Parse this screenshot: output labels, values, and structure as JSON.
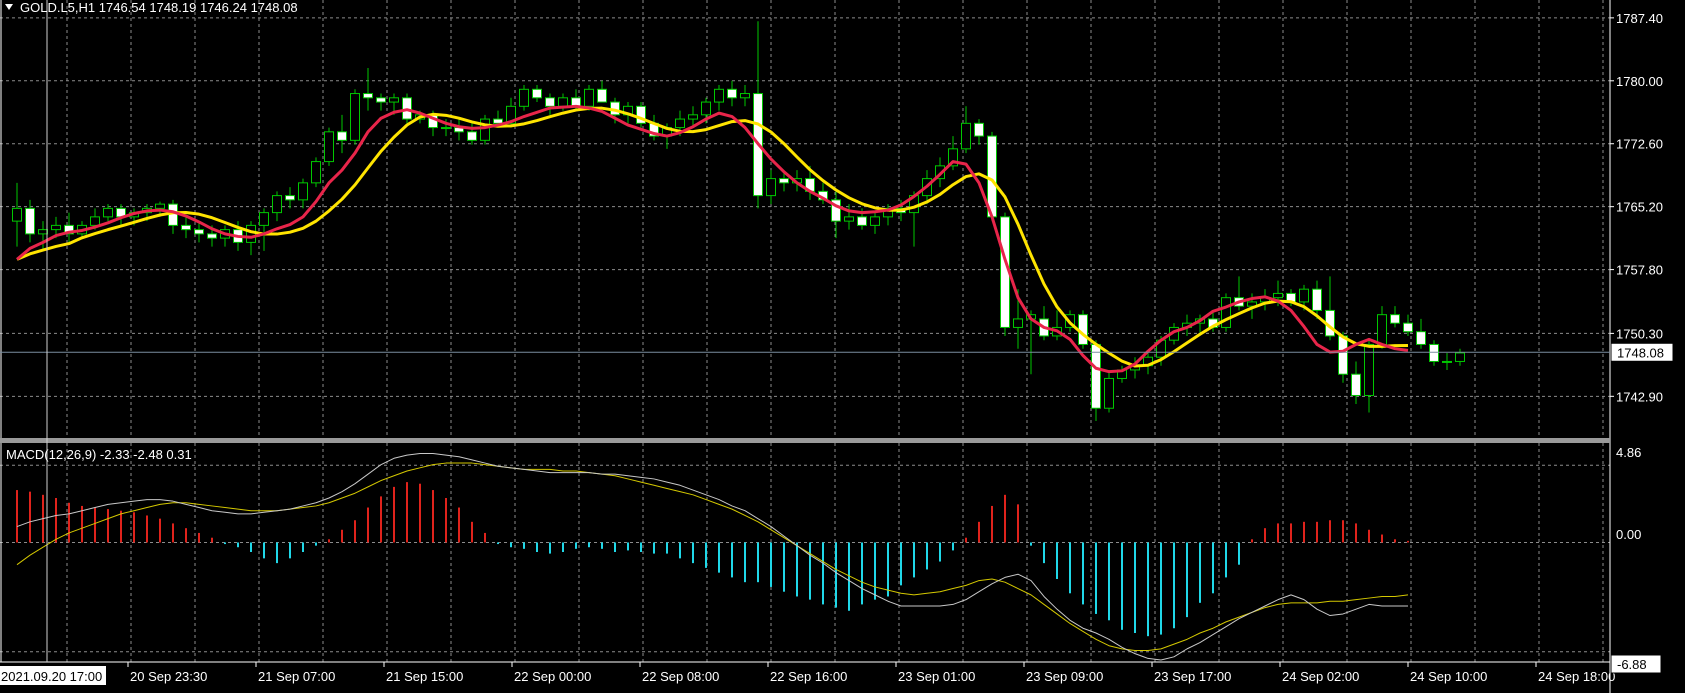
{
  "header": {
    "symbol_line": "GOLD.L5,H1  1746.54 1748.19 1746.24 1748.08"
  },
  "macd_panel": {
    "label": "MACD(12,26,9) -2.33 -2.48 0.31",
    "top_value": "4.86",
    "zero_value": "0.00",
    "bottom_value": "-6.88"
  },
  "colors": {
    "background": "#000000",
    "grid": "#8c8c8c",
    "bull_candle": "#00c800",
    "bear_candle": "#ffffff",
    "ma_fast": "#e8254a",
    "ma_slow": "#ffe400",
    "hist_pos": "#e0231c",
    "hist_neg": "#20d8e8",
    "macd_line": "#c8c8c8",
    "signal_line": "#d4c800"
  },
  "chart_data": [
    {
      "type": "candlestick",
      "symbol": "GOLD.L5",
      "timeframe": "H1",
      "last_price": "1748.08",
      "ylim": [
        1738.0,
        1789.5
      ],
      "price_ticks": [
        "1787.40",
        "1780.00",
        "1772.60",
        "1765.20",
        "1757.80",
        "1750.30",
        "1742.90"
      ],
      "time_ticks": [
        "2021.09.20 17:00",
        "20 Sep 23:30",
        "21 Sep 07:00",
        "21 Sep 15:00",
        "22 Sep 00:00",
        "22 Sep 08:00",
        "22 Sep 16:00",
        "23 Sep 01:00",
        "23 Sep 09:00",
        "23 Sep 17:00",
        "24 Sep 02:00",
        "24 Sep 10:00",
        "24 Sep 18:00"
      ],
      "candles": [
        [
          1763.5,
          1768.0,
          1760.5,
          1765.0
        ],
        [
          1765.0,
          1766.0,
          1761.0,
          1762.0
        ],
        [
          1762.0,
          1763.5,
          1760.0,
          1762.5
        ],
        [
          1762.5,
          1764.0,
          1761.5,
          1763.0
        ],
        [
          1763.0,
          1764.5,
          1761.0,
          1762.0
        ],
        [
          1762.0,
          1763.5,
          1761.5,
          1763.0
        ],
        [
          1763.0,
          1765.0,
          1762.5,
          1764.0
        ],
        [
          1764.0,
          1765.5,
          1763.5,
          1765.0
        ],
        [
          1765.0,
          1765.5,
          1763.0,
          1764.0
        ],
        [
          1764.0,
          1765.0,
          1763.0,
          1764.5
        ],
        [
          1764.5,
          1765.5,
          1763.5,
          1765.0
        ],
        [
          1765.0,
          1765.8,
          1764.0,
          1765.5
        ],
        [
          1765.5,
          1766.0,
          1762.0,
          1763.0
        ],
        [
          1763.0,
          1764.0,
          1761.5,
          1762.5
        ],
        [
          1762.5,
          1763.5,
          1761.0,
          1762.0
        ],
        [
          1762.0,
          1763.0,
          1760.5,
          1761.5
        ],
        [
          1761.5,
          1763.0,
          1760.5,
          1762.5
        ],
        [
          1762.5,
          1763.5,
          1760.0,
          1761.0
        ],
        [
          1761.0,
          1763.5,
          1759.5,
          1763.0
        ],
        [
          1763.0,
          1765.0,
          1760.0,
          1764.5
        ],
        [
          1764.5,
          1767.0,
          1763.5,
          1766.5
        ],
        [
          1766.5,
          1767.5,
          1765.0,
          1766.0
        ],
        [
          1766.0,
          1768.5,
          1765.0,
          1768.0
        ],
        [
          1768.0,
          1771.0,
          1767.5,
          1770.5
        ],
        [
          1770.5,
          1774.5,
          1770.0,
          1774.0
        ],
        [
          1774.0,
          1776.0,
          1771.5,
          1773.0
        ],
        [
          1773.0,
          1779.0,
          1772.5,
          1778.5
        ],
        [
          1778.5,
          1781.5,
          1776.5,
          1778.0
        ],
        [
          1778.0,
          1778.5,
          1776.5,
          1777.5
        ],
        [
          1777.5,
          1778.5,
          1776.0,
          1778.0
        ],
        [
          1778.0,
          1778.5,
          1775.0,
          1775.5
        ],
        [
          1775.5,
          1776.5,
          1775.0,
          1776.0
        ],
        [
          1776.0,
          1776.5,
          1773.5,
          1774.5
        ],
        [
          1774.5,
          1775.5,
          1773.5,
          1774.5
        ],
        [
          1774.5,
          1775.5,
          1773.0,
          1774.0
        ],
        [
          1774.0,
          1775.0,
          1772.5,
          1773.0
        ],
        [
          1773.0,
          1776.0,
          1772.5,
          1775.5
        ],
        [
          1775.5,
          1776.5,
          1774.5,
          1775.0
        ],
        [
          1775.0,
          1778.0,
          1774.5,
          1777.0
        ],
        [
          1777.0,
          1779.5,
          1776.5,
          1779.0
        ],
        [
          1779.0,
          1779.5,
          1777.5,
          1778.0
        ],
        [
          1778.0,
          1778.5,
          1776.0,
          1777.0
        ],
        [
          1777.0,
          1778.5,
          1776.5,
          1778.0
        ],
        [
          1778.0,
          1779.0,
          1776.5,
          1777.0
        ],
        [
          1777.0,
          1779.5,
          1776.5,
          1779.0
        ],
        [
          1779.0,
          1780.0,
          1777.5,
          1777.5
        ],
        [
          1777.5,
          1778.0,
          1775.0,
          1776.0
        ],
        [
          1776.0,
          1777.5,
          1775.0,
          1777.0
        ],
        [
          1777.0,
          1777.5,
          1774.5,
          1775.0
        ],
        [
          1775.0,
          1776.0,
          1773.0,
          1773.5
        ],
        [
          1773.5,
          1775.0,
          1772.0,
          1774.5
        ],
        [
          1774.5,
          1776.5,
          1773.5,
          1775.5
        ],
        [
          1775.5,
          1777.0,
          1774.5,
          1776.0
        ],
        [
          1776.0,
          1778.0,
          1775.0,
          1777.5
        ],
        [
          1777.5,
          1779.5,
          1776.5,
          1779.0
        ],
        [
          1779.0,
          1780.0,
          1777.0,
          1778.0
        ],
        [
          1778.0,
          1779.5,
          1777.0,
          1778.5
        ],
        [
          1778.5,
          1787.0,
          1765.0,
          1766.5
        ],
        [
          1766.5,
          1769.5,
          1765.5,
          1768.5
        ],
        [
          1768.5,
          1769.5,
          1767.0,
          1768.0
        ],
        [
          1768.0,
          1769.5,
          1767.0,
          1768.5
        ],
        [
          1768.5,
          1770.0,
          1766.0,
          1767.0
        ],
        [
          1767.0,
          1768.0,
          1765.5,
          1766.0
        ],
        [
          1766.0,
          1767.0,
          1761.5,
          1763.5
        ],
        [
          1763.5,
          1765.5,
          1762.5,
          1764.0
        ],
        [
          1764.0,
          1765.0,
          1762.5,
          1763.0
        ],
        [
          1763.0,
          1764.5,
          1762.0,
          1764.0
        ],
        [
          1764.0,
          1765.5,
          1763.0,
          1765.0
        ],
        [
          1765.0,
          1766.0,
          1763.5,
          1764.5
        ],
        [
          1764.5,
          1767.0,
          1760.5,
          1766.5
        ],
        [
          1766.5,
          1769.5,
          1765.5,
          1768.5
        ],
        [
          1768.5,
          1771.0,
          1767.5,
          1770.0
        ],
        [
          1770.0,
          1773.5,
          1769.5,
          1772.0
        ],
        [
          1772.0,
          1777.0,
          1771.5,
          1775.0
        ],
        [
          1775.0,
          1775.5,
          1772.5,
          1773.5
        ],
        [
          1773.5,
          1774.0,
          1763.5,
          1764.0
        ],
        [
          1764.0,
          1764.5,
          1750.0,
          1751.0
        ],
        [
          1751.0,
          1755.5,
          1748.5,
          1752.0
        ],
        [
          1752.0,
          1753.0,
          1745.5,
          1752.5
        ],
        [
          1752.0,
          1753.5,
          1749.5,
          1750.0
        ],
        [
          1750.0,
          1753.0,
          1749.5,
          1751.0
        ],
        [
          1751.0,
          1753.0,
          1750.5,
          1752.5
        ],
        [
          1752.5,
          1753.0,
          1748.5,
          1749.0
        ],
        [
          1749.0,
          1749.5,
          1740.0,
          1741.5
        ],
        [
          1741.5,
          1746.0,
          1741.0,
          1745.0
        ],
        [
          1745.0,
          1746.5,
          1744.5,
          1746.0
        ],
        [
          1746.0,
          1747.5,
          1745.0,
          1746.5
        ],
        [
          1746.5,
          1748.0,
          1745.5,
          1747.5
        ],
        [
          1747.5,
          1750.0,
          1746.5,
          1749.5
        ],
        [
          1749.5,
          1751.5,
          1749.0,
          1751.0
        ],
        [
          1751.0,
          1752.5,
          1750.0,
          1751.5
        ],
        [
          1751.5,
          1752.5,
          1750.0,
          1752.0
        ],
        [
          1752.0,
          1753.0,
          1750.5,
          1751.0
        ],
        [
          1751.0,
          1755.0,
          1750.5,
          1754.5
        ],
        [
          1754.5,
          1757.0,
          1753.0,
          1753.5
        ],
        [
          1753.5,
          1755.0,
          1752.0,
          1754.0
        ],
        [
          1754.0,
          1755.5,
          1753.0,
          1754.5
        ],
        [
          1754.5,
          1756.5,
          1753.5,
          1755.0
        ],
        [
          1755.0,
          1755.5,
          1753.5,
          1754.0
        ],
        [
          1754.0,
          1756.0,
          1753.0,
          1755.5
        ],
        [
          1755.5,
          1756.5,
          1752.0,
          1753.0
        ],
        [
          1753.0,
          1757.0,
          1749.5,
          1750.0
        ],
        [
          1750.0,
          1750.5,
          1744.5,
          1745.5
        ],
        [
          1745.5,
          1747.0,
          1742.0,
          1743.0
        ],
        [
          1743.0,
          1749.5,
          1741.0,
          1749.0
        ],
        [
          1749.0,
          1753.5,
          1748.5,
          1752.5
        ],
        [
          1752.5,
          1753.5,
          1751.0,
          1751.5
        ],
        [
          1751.5,
          1752.5,
          1750.0,
          1750.5
        ],
        [
          1750.5,
          1752.0,
          1748.5,
          1749.0
        ],
        [
          1749.0,
          1749.5,
          1746.5,
          1747.0
        ],
        [
          1747.0,
          1748.0,
          1746.0,
          1747.0
        ],
        [
          1747.0,
          1748.5,
          1746.5,
          1748.0
        ]
      ],
      "ma_fast": [
        1759.0,
        1760.3,
        1761.0,
        1761.8,
        1762.2,
        1762.4,
        1762.8,
        1763.3,
        1763.9,
        1764.4,
        1764.7,
        1764.8,
        1764.6,
        1764.1,
        1763.4,
        1762.6,
        1762.0,
        1761.7,
        1761.6,
        1762.0,
        1762.6,
        1763.1,
        1764.0,
        1765.8,
        1768.0,
        1769.5,
        1771.5,
        1774.0,
        1775.6,
        1776.3,
        1776.6,
        1776.2,
        1775.6,
        1775.0,
        1774.6,
        1774.4,
        1774.5,
        1774.8,
        1775.2,
        1775.8,
        1776.3,
        1776.8,
        1776.9,
        1777.0,
        1776.8,
        1776.4,
        1775.6,
        1774.8,
        1774.3,
        1773.8,
        1773.5,
        1773.9,
        1774.6,
        1775.5,
        1776.2,
        1775.8,
        1774.5,
        1772.6,
        1770.8,
        1769.3,
        1768.0,
        1767.0,
        1766.2,
        1765.3,
        1764.7,
        1764.5,
        1764.6,
        1764.8,
        1765.4,
        1766.4,
        1767.6,
        1769.0,
        1770.5,
        1770.2,
        1768.0,
        1764.0,
        1759.0,
        1754.5,
        1752.0,
        1751.0,
        1750.6,
        1749.6,
        1747.7,
        1746.2,
        1745.8,
        1745.9,
        1746.7,
        1748.2,
        1749.5,
        1750.5,
        1751.0,
        1751.8,
        1752.9,
        1753.4,
        1754.0,
        1754.4,
        1754.6,
        1754.1,
        1753.0,
        1751.1,
        1749.0,
        1748.1,
        1748.2,
        1749.0,
        1749.6,
        1749.0,
        1748.5,
        1748.3
      ]
    },
    {
      "type": "macd",
      "name": "MACD(12,26,9)",
      "params": [
        12,
        26,
        9
      ],
      "ylim": [
        -7.4,
        6.2
      ],
      "ticks": [
        "4.86",
        "0.00",
        "-6.88"
      ],
      "histogram": [
        3.3,
        3.2,
        3.0,
        2.8,
        2.5,
        2.3,
        2.2,
        2.1,
        2.0,
        1.9,
        1.7,
        1.5,
        1.2,
        0.9,
        0.6,
        0.3,
        -0.1,
        -0.3,
        -0.6,
        -1.0,
        -1.3,
        -1.0,
        -0.6,
        -0.2,
        0.2,
        0.8,
        1.4,
        2.2,
        2.9,
        3.5,
        3.8,
        3.7,
        3.3,
        2.8,
        2.2,
        1.3,
        0.6,
        -0.1,
        -0.3,
        -0.4,
        -0.6,
        -0.7,
        -0.6,
        -0.4,
        -0.3,
        -0.4,
        -0.6,
        -0.5,
        -0.6,
        -0.7,
        -0.7,
        -1.0,
        -1.3,
        -1.6,
        -1.9,
        -2.2,
        -2.5,
        -2.5,
        -2.8,
        -3.1,
        -3.4,
        -3.6,
        -3.9,
        -4.1,
        -4.3,
        -3.9,
        -3.6,
        -3.4,
        -2.7,
        -2.2,
        -1.7,
        -1.2,
        -0.5,
        0.3,
        1.3,
        2.3,
        3.0,
        2.4,
        -0.2,
        -1.3,
        -2.3,
        -3.2,
        -3.9,
        -4.5,
        -4.9,
        -5.5,
        -5.7,
        -5.9,
        -5.8,
        -5.4,
        -4.7,
        -3.8,
        -3.2,
        -2.2,
        -1.4,
        0.2,
        0.9,
        1.2,
        1.2,
        1.3,
        1.3,
        1.4,
        1.4,
        1.2,
        0.8,
        0.5,
        0.2,
        0.1
      ],
      "macd": [
        1.0,
        1.3,
        1.5,
        1.7,
        1.8,
        2.0,
        2.2,
        2.4,
        2.5,
        2.6,
        2.7,
        2.7,
        2.6,
        2.4,
        2.2,
        2.0,
        1.9,
        1.8,
        1.8,
        1.9,
        2.0,
        2.1,
        2.3,
        2.5,
        2.8,
        3.2,
        3.7,
        4.3,
        4.9,
        5.3,
        5.5,
        5.6,
        5.6,
        5.5,
        5.4,
        5.2,
        5.0,
        4.8,
        4.7,
        4.6,
        4.5,
        4.4,
        4.4,
        4.4,
        4.4,
        4.3,
        4.3,
        4.2,
        4.1,
        4.0,
        3.8,
        3.6,
        3.3,
        3.0,
        2.7,
        2.3,
        2.0,
        1.5,
        1.0,
        0.4,
        -0.2,
        -0.8,
        -1.3,
        -1.9,
        -2.4,
        -2.9,
        -3.3,
        -3.7,
        -4.0,
        -4.0,
        -4.0,
        -4.0,
        -3.9,
        -3.6,
        -3.1,
        -2.6,
        -2.2,
        -2.0,
        -2.4,
        -3.4,
        -4.2,
        -4.9,
        -5.4,
        -5.7,
        -6.1,
        -6.6,
        -7.0,
        -7.3,
        -7.4,
        -7.2,
        -6.7,
        -6.3,
        -5.8,
        -5.3,
        -4.8,
        -4.4,
        -4.0,
        -3.6,
        -3.3,
        -3.6,
        -4.2,
        -4.6,
        -4.5,
        -4.2,
        -3.9,
        -4.0,
        -4.0,
        -4.0
      ],
      "signal": [
        -1.4,
        -0.8,
        -0.3,
        0.2,
        0.6,
        0.9,
        1.2,
        1.5,
        1.8,
        2.0,
        2.2,
        2.4,
        2.5,
        2.5,
        2.4,
        2.3,
        2.2,
        2.1,
        2.0,
        2.0,
        2.0,
        2.1,
        2.2,
        2.3,
        2.5,
        2.8,
        3.1,
        3.5,
        3.9,
        4.2,
        4.5,
        4.7,
        4.9,
        5.0,
        5.0,
        5.0,
        4.9,
        4.8,
        4.7,
        4.6,
        4.6,
        4.6,
        4.5,
        4.5,
        4.4,
        4.3,
        4.2,
        4.0,
        3.8,
        3.6,
        3.4,
        3.2,
        3.0,
        2.7,
        2.4,
        2.1,
        1.7,
        1.3,
        0.8,
        0.3,
        -0.2,
        -0.7,
        -1.2,
        -1.7,
        -2.1,
        -2.5,
        -2.8,
        -3.0,
        -3.2,
        -3.3,
        -3.2,
        -3.1,
        -2.9,
        -2.7,
        -2.4,
        -2.3,
        -2.5,
        -2.9,
        -3.3,
        -3.9,
        -4.5,
        -5.1,
        -5.6,
        -6.1,
        -6.5,
        -6.7,
        -6.8,
        -6.8,
        -6.7,
        -6.4,
        -6.1,
        -5.7,
        -5.4,
        -5.0,
        -4.7,
        -4.4,
        -4.1,
        -3.9,
        -3.8,
        -3.8,
        -3.8,
        -3.7,
        -3.7,
        -3.6,
        -3.5,
        -3.4,
        -3.4,
        -3.3
      ]
    }
  ]
}
